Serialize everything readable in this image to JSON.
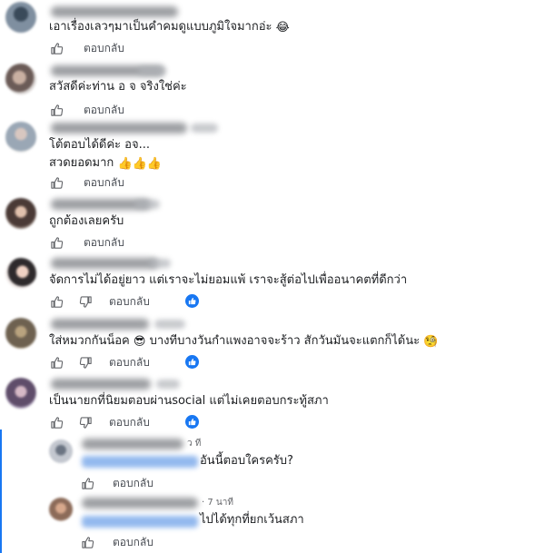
{
  "colors": {
    "accent": "#1877f2",
    "text": "#1c1e21",
    "muted": "#65676b"
  },
  "comments": [
    {
      "text": "เอาเรื่องเลวๆมาเป็นคำคมดูแบบภูมิใจมากอ่ะ",
      "emoji": "😂",
      "reply_label": "ตอบกลับ"
    },
    {
      "text": "สวัสดีค่ะท่าน อ จ จริงใช่ค่ะ",
      "reply_label": "ตอบกลับ"
    },
    {
      "line1": "โต้ตอบได้ดีค่ะ อจ...",
      "line2": "สวดยอดมาก",
      "emoji": "👍👍👍",
      "reply_label": "ตอบกลับ"
    },
    {
      "text": "ถูกต้องเลยครับ",
      "reply_label": "ตอบกลับ"
    },
    {
      "text": "จัดการไม่ได้อยู่ยาว แต่เราจะไม่ยอมแพ้ เราจะสู้ต่อไปเพื่ออนาคตที่ดีกว่า",
      "reply_label": "ตอบกลับ",
      "reactions": "like"
    },
    {
      "text_a": "ใส่หมวกกันน็อค",
      "emoji_a": "😎",
      "text_b": "บางทีบางวันกำแพงอาจจะร้าว สักวันมันจะแตกก็ได้นะ",
      "emoji_b": "🧐",
      "reply_label": "ตอบกลับ",
      "reactions": "like"
    },
    {
      "text": "เป็นนายกที่นิยมตอบผ่านsocial แต่ไม่เคยตอบกระทู้สภา",
      "reply_label": "ตอบกลับ",
      "reactions": "like"
    }
  ],
  "replies": [
    {
      "time": "ว ที",
      "text": "อันนี้ตอบใครครับ?",
      "reply_label": "ตอบกลับ"
    },
    {
      "time": "· 7 นาที",
      "text": "ไปได้ทุกที่ยกเว้นสภา",
      "reply_label": "ตอบกลับ"
    }
  ],
  "icons": {
    "like": "thumbs-up-icon",
    "dislike": "thumbs-down-icon",
    "reaction": "like-reaction-icon"
  }
}
